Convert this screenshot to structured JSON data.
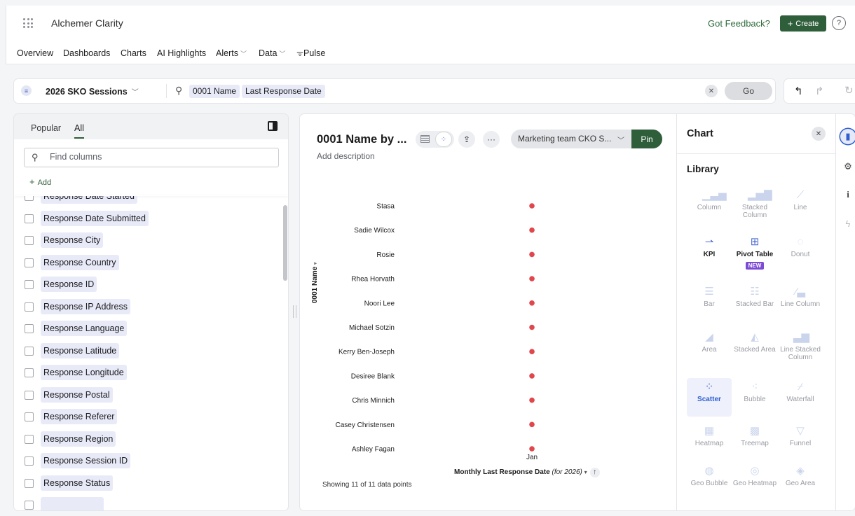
{
  "app": {
    "name": "Alchemer Clarity",
    "feedback": "Got Feedback?",
    "create_label": "Create",
    "help_glyph": "?"
  },
  "nav": [
    {
      "label": "Overview"
    },
    {
      "label": "Dashboards"
    },
    {
      "label": "Charts"
    },
    {
      "label": "AI Highlights"
    },
    {
      "label": "Alerts",
      "dropdown": true
    },
    {
      "label": "Data",
      "dropdown": true
    },
    {
      "label": "Pulse",
      "icon": "pulse-icon"
    }
  ],
  "search": {
    "worksheet": "2026 SKO Sessions",
    "tokens": [
      "0001 Name",
      "Last Response Date"
    ],
    "go_label": "Go"
  },
  "left_panel": {
    "tabs": [
      "Popular",
      "All"
    ],
    "active_tab": "All",
    "find_placeholder": "Find columns",
    "add_label": "Add",
    "columns": [
      "Response Date Started",
      "Response Date Submitted",
      "Response City",
      "Response Country",
      "Response ID",
      "Response IP Address",
      "Response Language",
      "Response Latitude",
      "Response Longitude",
      "Response Postal",
      "Response Referer",
      "Response Region",
      "Response Session ID",
      "Response Status",
      ""
    ]
  },
  "chart_header": {
    "title": "0001 Name by ...",
    "description_placeholder": "Add description",
    "pin_target": "Marketing team CKO S...",
    "pin_label": "Pin"
  },
  "chart_data": {
    "type": "scatter",
    "categories": [
      "Stasa",
      "Sadie Wilcox",
      "Rosie",
      "Rhea Horvath",
      "Noori Lee",
      "Michael Sotzin",
      "Kerry Ben-Joseph",
      "Desiree Blank",
      "Chris Minnich",
      "Casey Christensen",
      "Ashley Fagan"
    ],
    "x_ticks": [
      "Jan"
    ],
    "series": [
      {
        "values": [
          "Jan",
          "Jan",
          "Jan",
          "Jan",
          "Jan",
          "Jan",
          "Jan",
          "Jan",
          "Jan",
          "Jan",
          "Jan"
        ],
        "color": "#e0474c"
      }
    ],
    "ylabel": "0001 Name",
    "xlabel": "Monthly Last Response Date",
    "xlabel_suffix": "(for 2026)",
    "footer": "Showing 11 of 11 data points",
    "grid": false
  },
  "chart_panel": {
    "title": "Chart",
    "library_label": "Library",
    "types": [
      {
        "label": "Column",
        "icon": "column-chart-icon",
        "state": "disabled"
      },
      {
        "label": "Stacked Column",
        "icon": "stacked-column-icon",
        "state": "disabled"
      },
      {
        "label": "Line",
        "icon": "line-chart-icon",
        "state": "disabled"
      },
      {
        "label": "KPI",
        "icon": "kpi-icon",
        "state": "available"
      },
      {
        "label": "Pivot Table",
        "icon": "pivot-table-icon",
        "state": "available",
        "badge": "NEW"
      },
      {
        "label": "Donut",
        "icon": "donut-icon",
        "state": "disabled"
      },
      {
        "label": "Bar",
        "icon": "bar-chart-icon",
        "state": "disabled"
      },
      {
        "label": "Stacked Bar",
        "icon": "stacked-bar-icon",
        "state": "disabled"
      },
      {
        "label": "Line Column",
        "icon": "line-column-icon",
        "state": "disabled"
      },
      {
        "label": "Area",
        "icon": "area-chart-icon",
        "state": "disabled"
      },
      {
        "label": "Stacked Area",
        "icon": "stacked-area-icon",
        "state": "disabled"
      },
      {
        "label": "Line Stacked Column",
        "icon": "line-stacked-column-icon",
        "state": "disabled"
      },
      {
        "label": "Scatter",
        "icon": "scatter-icon",
        "state": "selected"
      },
      {
        "label": "Bubble",
        "icon": "bubble-icon",
        "state": "disabled"
      },
      {
        "label": "Waterfall",
        "icon": "waterfall-icon",
        "state": "disabled"
      },
      {
        "label": "Heatmap",
        "icon": "heatmap-icon",
        "state": "disabled"
      },
      {
        "label": "Treemap",
        "icon": "treemap-icon",
        "state": "disabled"
      },
      {
        "label": "Funnel",
        "icon": "funnel-icon",
        "state": "disabled"
      },
      {
        "label": "Geo Bubble",
        "icon": "geo-bubble-icon",
        "state": "disabled"
      },
      {
        "label": "Geo Heatmap",
        "icon": "geo-heatmap-icon",
        "state": "disabled"
      },
      {
        "label": "Geo Area",
        "icon": "geo-area-icon",
        "state": "disabled"
      }
    ]
  },
  "rail": [
    "chart-settings-icon",
    "gear-icon",
    "info-icon",
    "lightning-icon"
  ],
  "colors": {
    "brand_green": "#2f5e3b",
    "token_bg": "#e8eaf8",
    "point": "#e0474c",
    "selected_blue": "#2d5fd1",
    "new_badge": "#7b4bd6"
  }
}
